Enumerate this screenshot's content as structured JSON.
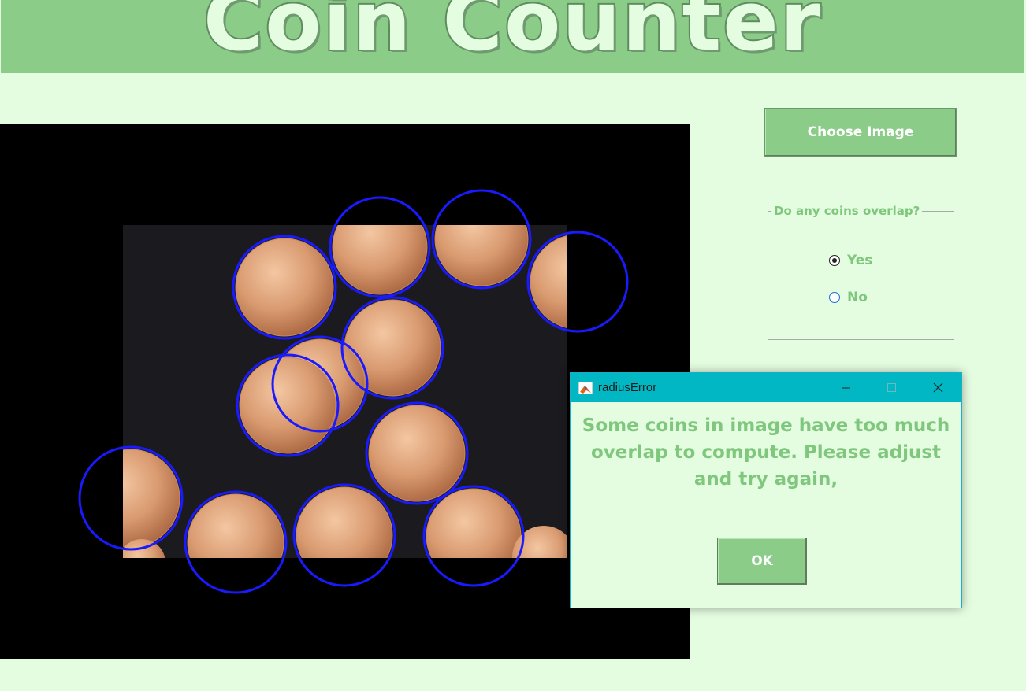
{
  "app": {
    "title": "Coin Counter"
  },
  "controls": {
    "choose_image_label": "Choose Image",
    "overlap_group": {
      "legend": "Do any coins overlap?",
      "options": [
        {
          "label": "Yes",
          "selected": true
        },
        {
          "label": "No",
          "selected": false
        }
      ]
    }
  },
  "dialog": {
    "title": "radiusError",
    "message": "Some coins in image have too much overlap to compute. Please adjust and try again,",
    "ok_label": "OK",
    "window_buttons": [
      "minimize-icon",
      "maximize-icon",
      "close-icon"
    ]
  },
  "image": {
    "detected_circle_count": 13,
    "circle_color": "#1a1aff"
  },
  "colors": {
    "background": "#e4fce0",
    "accent": "#8acc88",
    "text_accent": "#7fc77d",
    "dialog_titlebar": "#00b7c3"
  }
}
